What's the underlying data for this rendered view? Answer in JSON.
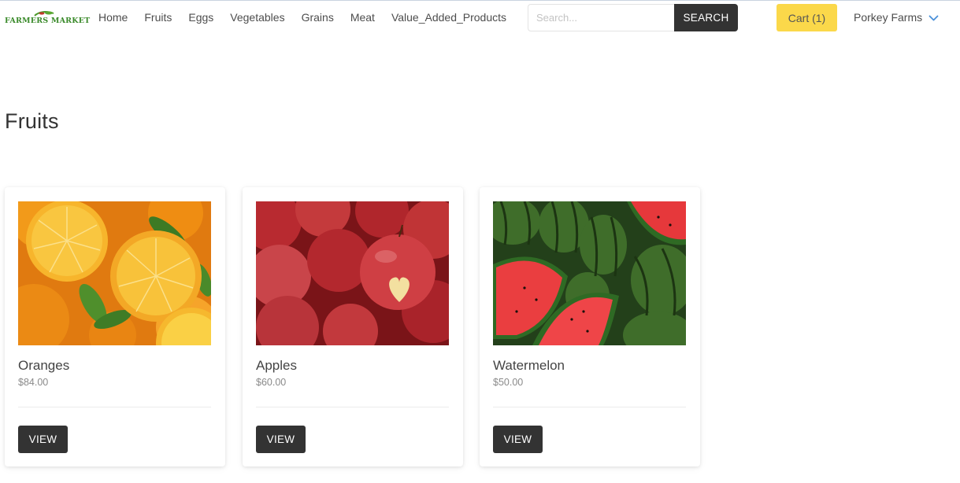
{
  "brand": {
    "logo_text": "FARMERS MARKET",
    "color": "#3a8a2a"
  },
  "nav": {
    "links": [
      "Home",
      "Fruits",
      "Eggs",
      "Vegetables",
      "Grains",
      "Meat",
      "Value_Added_Products"
    ]
  },
  "search": {
    "placeholder": "Search...",
    "value": "",
    "button_label": "SEARCH"
  },
  "cart": {
    "label": "Cart (1)",
    "color": "#fbd84a"
  },
  "user": {
    "name": "Porkey Farms",
    "icon": "chevron-down-icon"
  },
  "page": {
    "title": "Fruits"
  },
  "products": [
    {
      "name": "Oranges",
      "price": "$84.00",
      "button_label": "VIEW",
      "image": "oranges-photo"
    },
    {
      "name": "Apples",
      "price": "$60.00",
      "button_label": "VIEW",
      "image": "apples-photo"
    },
    {
      "name": "Watermelon",
      "price": "$50.00",
      "button_label": "VIEW",
      "image": "watermelon-photo"
    }
  ],
  "colors": {
    "dark_button": "#333333",
    "accent_link": "#4a90d9"
  }
}
